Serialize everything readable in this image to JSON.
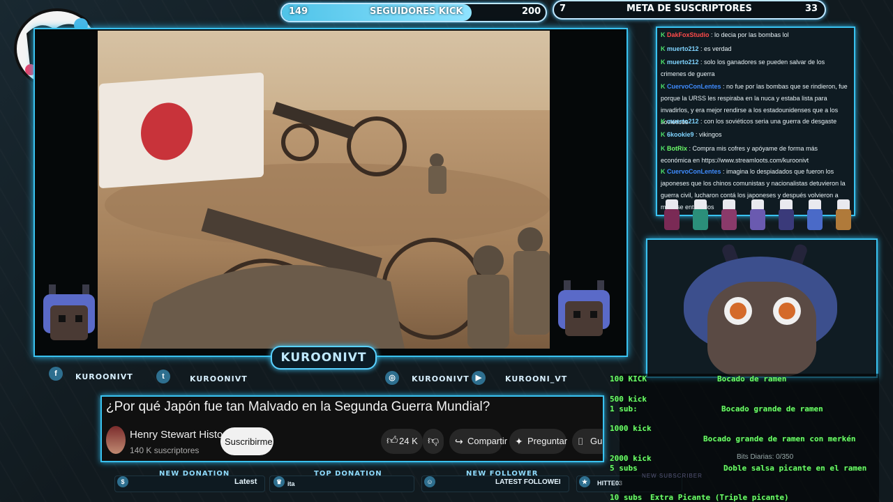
{
  "top_bars": {
    "followers": {
      "current": "149",
      "label": "SEGUIDORES KICK",
      "goal": "200",
      "fill_fraction": 0.72
    },
    "subs": {
      "current": "7",
      "label": "META DE SUSCRIPTORES",
      "goal": "33",
      "fill_fraction": 0.0
    }
  },
  "stream": {
    "name": "KUROONIVT"
  },
  "socials": [
    {
      "icon": "facebook-icon",
      "glyph": "f",
      "label": "KUROONIVT"
    },
    {
      "icon": "twitter-icon",
      "glyph": "t",
      "label": "KUROONIVT"
    },
    {
      "icon": "instagram-icon",
      "glyph": "◎",
      "label": "KUROONIVT"
    },
    {
      "icon": "youtube-icon",
      "glyph": "▶",
      "label": "KUROONI_VT"
    }
  ],
  "youtube": {
    "title": "¿Por qué Japón fue tan Malvado en la Segunda Guerra Mundial?",
    "channel": "Henry Stewart Historia",
    "subscribers": "140 K suscriptores",
    "subscribe_label": "Suscribirme",
    "likes": "24 K",
    "share_label": "Compartir",
    "ask_label": "Preguntar",
    "save_label": "Gu"
  },
  "bottom": {
    "new_donation": "NEW DONATION",
    "new_donation_value": "Latest",
    "top_donation": "TOP DONATION",
    "top_donation_value": "ita",
    "new_follower": "NEW FOLLOWER",
    "new_follower_value": "LATEST FOLLOWEI",
    "extra_value": "HITTE03"
  },
  "chat": [
    {
      "user": "DakFoxStudio",
      "color": "#ff4a4a",
      "text": " : lo decia por las bombas lol"
    },
    {
      "user": "muerto212",
      "color": "#7fd4ff",
      "text": " : es verdad"
    },
    {
      "user": "muerto212",
      "color": "#7fd4ff",
      "text": " : solo los ganadores se pueden salvar de los crimenes de guerra"
    },
    {
      "user": "CuervoConLentes",
      "color": "#3f8cff",
      "text": " : no fue por las bombas que se rindieron, fue porque la URSS les respiraba en la nuca y estaba lista para invadirlos, y era mejor rendirse a los estadounidenses que a los soviéticos"
    },
    {
      "user": "muerto212",
      "color": "#7fd4ff",
      "text": " : con los soviéticos seria una guerra de desgaste"
    },
    {
      "user": "6kookie9",
      "color": "#7fd4ff",
      "text": " : vikingos"
    },
    {
      "user": "BotRix",
      "color": "#6dff6a",
      "text": " : Compra mis cofres y apóyame de forma más económica en https://www.streamloots.com/kuroonivt"
    },
    {
      "user": "CuervoConLentes",
      "color": "#3f8cff",
      "text": " : imagina lo despiadados que fueron los japoneses que los chinos comunistas y nacionalistas detuvieron la guerra civil, lucharon contá los japoneses y después volvieron a matarse entre ellos"
    }
  ],
  "rewards": [
    {
      "left": "100 KICK",
      "right": "Bocado de ramen"
    },
    {
      "left": "500 kick",
      "right": ""
    },
    {
      "left": "1 sub:",
      "right": "Bocado grande de ramen"
    },
    {
      "left": "1000 kick",
      "right": "Bocado grande de ramen con merkén"
    },
    {
      "left": "2000 kick",
      "right": ""
    },
    {
      "left": "5 subs",
      "right": "Doble salsa picante en el ramen"
    },
    {
      "left": "10 subs",
      "right": "Extra Picante (Triple picante)"
    }
  ],
  "bits": "Bits Diarias: 0/350",
  "new_subscriber": "NEW SUBSCRIBER",
  "colors": {
    "accent": "#39c2f0",
    "reward_green": "#6dff6a"
  }
}
